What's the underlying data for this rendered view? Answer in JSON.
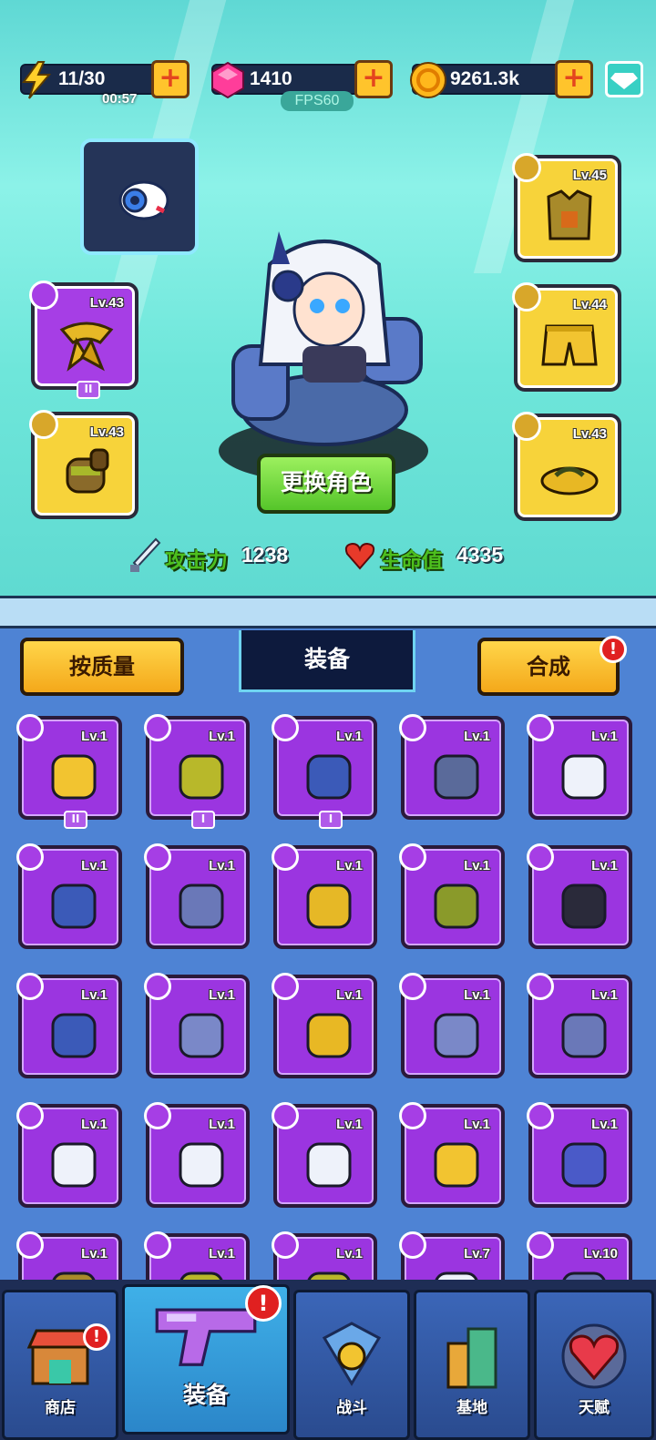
{
  "resources": {
    "energy": "11/30",
    "energy_timer": "00:57",
    "gems": "1410",
    "coins": "9261.3k",
    "plus": "+"
  },
  "fps": "FPS60",
  "equipped": {
    "left": [
      {
        "level": "Lv.43",
        "item": "scarf",
        "tag": "II"
      },
      {
        "level": "Lv.43",
        "item": "glove"
      }
    ],
    "right": [
      {
        "level": "Lv.45",
        "item": "armor"
      },
      {
        "level": "Lv.44",
        "item": "shorts"
      },
      {
        "level": "Lv.43",
        "item": "sandal"
      }
    ]
  },
  "change_character": "更换角色",
  "stats": {
    "attack_label": "攻击力",
    "attack_value": "1238",
    "hp_label": "生命值",
    "hp_value": "4335"
  },
  "inventory_header": {
    "sort_button": "按质量",
    "title": "装备",
    "combine_button": "合成",
    "alert": "!"
  },
  "inventory": [
    {
      "level": "Lv.1",
      "item": "shirt",
      "tag": "II"
    },
    {
      "level": "Lv.1",
      "item": "pants",
      "tag": "I"
    },
    {
      "level": "Lv.1",
      "item": "necklace",
      "tag": "I"
    },
    {
      "level": "Lv.1",
      "item": "pants-mech"
    },
    {
      "level": "Lv.1",
      "item": "sock"
    },
    {
      "level": "Lv.1",
      "item": "necklace"
    },
    {
      "level": "Lv.1",
      "item": "armor-mech"
    },
    {
      "level": "Lv.1",
      "item": "scarf"
    },
    {
      "level": "Lv.1",
      "item": "boot"
    },
    {
      "level": "Lv.1",
      "item": "necklace-gem"
    },
    {
      "level": "Lv.1",
      "item": "necklace"
    },
    {
      "level": "Lv.1",
      "item": "boot-mech"
    },
    {
      "level": "Lv.1",
      "item": "sandal"
    },
    {
      "level": "Lv.1",
      "item": "boot-mech"
    },
    {
      "level": "Lv.1",
      "item": "armor-mech"
    },
    {
      "level": "Lv.1",
      "item": "tank-top"
    },
    {
      "level": "Lv.1",
      "item": "sock"
    },
    {
      "level": "Lv.1",
      "item": "shorts-white"
    },
    {
      "level": "Lv.1",
      "item": "shirt"
    },
    {
      "level": "Lv.1",
      "item": "glove-mech"
    },
    {
      "level": "Lv.1",
      "item": "armor"
    },
    {
      "level": "Lv.1",
      "item": "pants"
    },
    {
      "level": "Lv.1",
      "item": "pants"
    },
    {
      "level": "Lv.7",
      "item": "sock"
    },
    {
      "level": "Lv.10",
      "item": "armor-mech"
    }
  ],
  "nav": [
    {
      "label": "商店",
      "icon": "shop-icon",
      "alert": "!"
    },
    {
      "label": "装备",
      "icon": "weapon-icon",
      "alert": "!"
    },
    {
      "label": "战斗",
      "icon": "battle-icon"
    },
    {
      "label": "基地",
      "icon": "base-icon"
    },
    {
      "label": "天赋",
      "icon": "talent-icon"
    }
  ]
}
